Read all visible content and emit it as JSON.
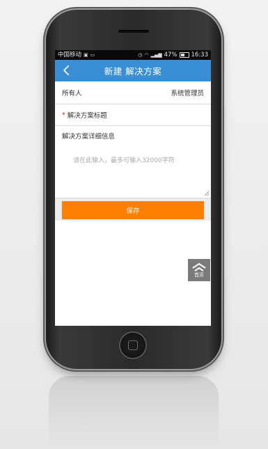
{
  "statusbar": {
    "carrier": "中国移动",
    "battery_pct": "47%",
    "time": "16:33"
  },
  "navbar": {
    "title": "新建 解决方案"
  },
  "form": {
    "owner_label": "所有人",
    "owner_value": "系统管理员",
    "title_required_mark": "*",
    "title_label": "解决方案标题",
    "detail_label": "解决方案详细信息",
    "detail_placeholder": "请在此输入，最多可输入32000字符",
    "save_label": "保存"
  },
  "home_float": {
    "label": "首页"
  },
  "colors": {
    "navbar": "#3a8fd4",
    "save_button": "#ff7f00",
    "required_mark": "#e02020"
  }
}
